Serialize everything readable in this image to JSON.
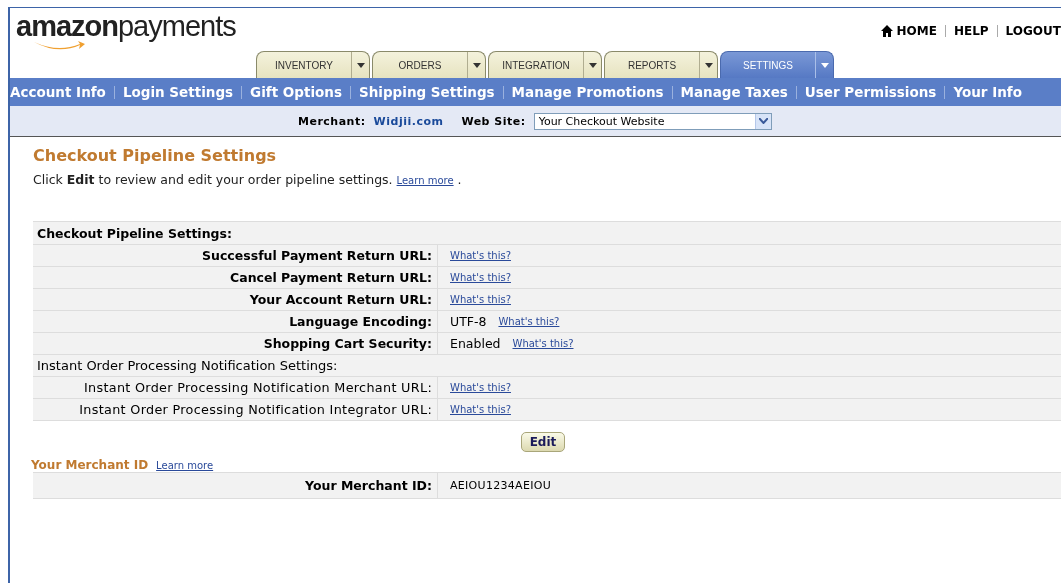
{
  "logo": {
    "text": "**amazon**payments"
  },
  "top_links": [
    {
      "label": "HOME",
      "kind": "home"
    },
    {
      "label": "HELP",
      "kind": "plain"
    },
    {
      "label": "LOGOUT",
      "kind": "plain"
    }
  ],
  "tabs": [
    {
      "label": "INVENTORY",
      "selected": false
    },
    {
      "label": "ORDERS",
      "selected": false
    },
    {
      "label": "INTEGRATION",
      "selected": false
    },
    {
      "label": "REPORTS",
      "selected": false
    },
    {
      "label": "SETTINGS",
      "selected": true
    }
  ],
  "subnav": [
    "Account Info",
    "Login Settings",
    "Gift Options",
    "Shipping Settings",
    "Manage Promotions",
    "Manage Taxes",
    "User Permissions",
    "Your Info"
  ],
  "merchant_bar": {
    "merchant_label": "Merchant:",
    "merchant": "Widjii.com",
    "website_label": "Web Site:",
    "website": "Your Checkout Website"
  },
  "title": "Checkout Pipeline Settings",
  "intro": {
    "text": "Click **Edit** to review and edit your order pipeline settings.",
    "link": "Learn more",
    "after": "."
  },
  "settings_rows": [
    {
      "kind": "header",
      "label": "Checkout Pipeline Settings:"
    },
    {
      "kind": "field",
      "label": "Successful Payment Return URL:",
      "link": "What's this?"
    },
    {
      "kind": "field",
      "label": "Cancel Payment Return URL:",
      "link": "What's this?"
    },
    {
      "kind": "field",
      "label": "Your Account Return URL:",
      "link": "What's this?"
    },
    {
      "kind": "field",
      "label": "Language Encoding:",
      "value": "UTF-8",
      "link": "What's this?"
    },
    {
      "kind": "field",
      "label": "Shopping Cart Security:",
      "value": "Enabled",
      "link": "What's this?"
    },
    {
      "kind": "section",
      "label": "Instant Order Processing Notification Settings:"
    },
    {
      "kind": "subfield",
      "label": "Instant Order Processing Notification Merchant URL:",
      "link": "What's this?"
    },
    {
      "kind": "subfield",
      "label": "Instant Order Processing Notification Integrator URL:",
      "link": "What's this?"
    }
  ],
  "edit_button": "Edit",
  "merchant_id": {
    "heading": "Your Merchant ID",
    "link": "Learn more",
    "label": "Your Merchant ID:",
    "value": "AEIOU1234AEIOU"
  }
}
